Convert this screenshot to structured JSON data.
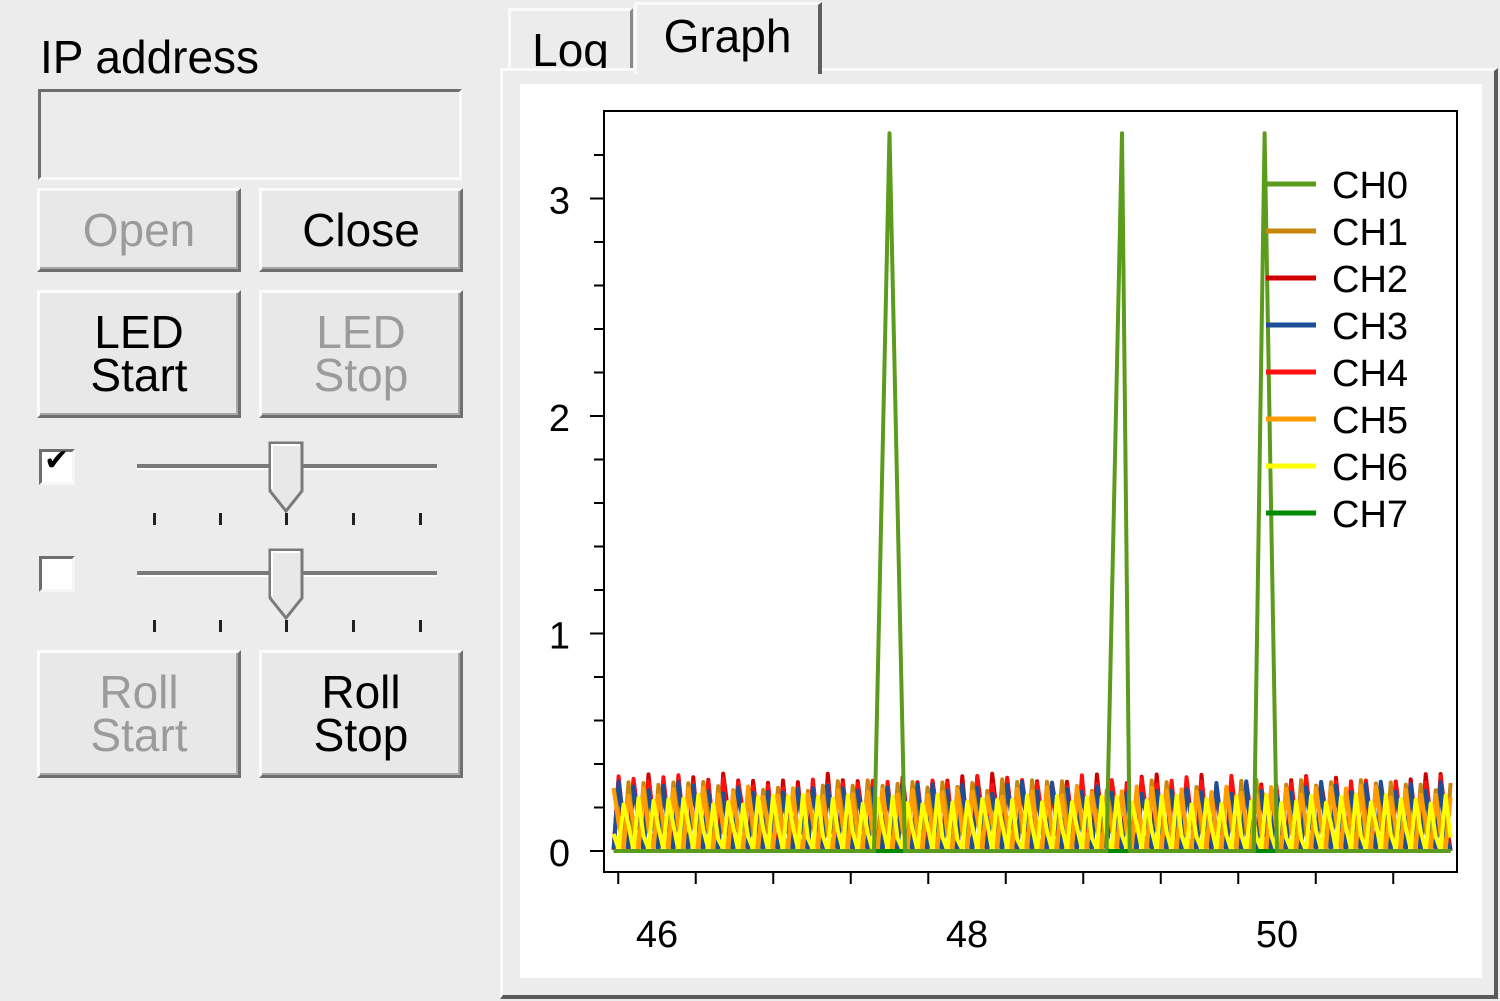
{
  "connection": {
    "ip_label": "IP address",
    "ip_value": "",
    "open_label": "Open",
    "close_label": "Close"
  },
  "led": {
    "start_label": "LED\nStart",
    "stop_label": "LED\nStop",
    "checkbox_checked": true,
    "slider_value": 0.5
  },
  "roll": {
    "checkbox_checked": false,
    "slider_value": 0.5,
    "start_label": "Roll\nStart",
    "stop_label": "Roll\nStop"
  },
  "tabs": [
    "Log",
    "Graph"
  ],
  "active_tab": "Graph",
  "chart_data": {
    "type": "line",
    "xlim": [
      45.7,
      51.15
    ],
    "ylim": [
      -0.1,
      3.3
    ],
    "x_ticks": [
      46,
      48,
      50
    ],
    "y_ticks": [
      0,
      1,
      2,
      3
    ],
    "legend_position": "top-right",
    "grid": false,
    "series": [
      {
        "name": "CH0",
        "color": "#5c9c1c",
        "baseline": 0,
        "spikes": [
          [
            47.4,
            47.5,
            47.6
          ],
          [
            48.9,
            49.0,
            49.05
          ],
          [
            49.85,
            49.92,
            50.0
          ]
        ],
        "spike_value": 3.3
      },
      {
        "name": "CH1",
        "color": "#c8860a",
        "min": 0.0,
        "max": 0.33
      },
      {
        "name": "CH2",
        "color": "#d00000",
        "min": 0.0,
        "max": 0.36
      },
      {
        "name": "CH3",
        "color": "#1f4e99",
        "min": 0.0,
        "max": 0.32
      },
      {
        "name": "CH4",
        "color": "#ff1010",
        "min": 0.0,
        "max": 0.35
      },
      {
        "name": "CH5",
        "color": "#ff9d00",
        "min": 0.0,
        "max": 0.3
      },
      {
        "name": "CH6",
        "color": "#ffff00",
        "min": 0.0,
        "max": 0.26
      },
      {
        "name": "CH7",
        "color": "#008a00",
        "baseline": 0
      }
    ]
  }
}
